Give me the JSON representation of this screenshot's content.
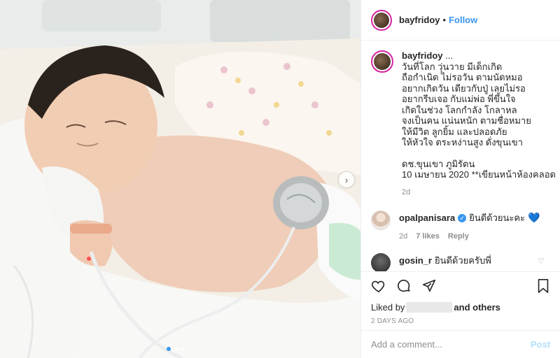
{
  "post": {
    "username": "bayfridoy",
    "follow_label": "Follow",
    "separator": "•",
    "caption_more": "...",
    "caption_lines": [
      "วันที่โลก วุ่นวาย มีเด็กเกิด",
      "ถือกำเนิด ไม่รอวัน ตามนัดหมอ",
      "อยากเกิดวัน เดียวกับปู่ เลยไม่รอ",
      "อยากรีบเจอ กับแม่พ่อ พี่ขึ้นใจ",
      "เกิดในช่วง โลกกำลัง โกลาหล",
      "จงเป็นคน แน่นหนัก ตามชื่อหมาย",
      "ให้มีวิต ลูกยิ้ม และปลอดภัย",
      "ให้หัวใจ ตระหง่านสูง ดั่งขุนเขา",
      "",
      "ดช.ขุนเขา ภูมิรัตน",
      "10 เมษายน 2020 **เขียนหน้าห้องคลอด"
    ],
    "caption_time": "2d"
  },
  "comments": [
    {
      "username": "opalpanisara",
      "verified_glyph": "✓",
      "text": "ยินดีด้วยนะคะ",
      "emoji": "💙",
      "time": "2d",
      "likes": "7 likes",
      "reply": "Reply",
      "like_glyph": "♡"
    },
    {
      "username": "gosin_r",
      "text": "ยินดีด้วยครับพี่",
      "like_glyph": "♡"
    }
  ],
  "liked": {
    "prefix": "Liked by",
    "and_others": "and others"
  },
  "date": "2 DAYS AGO",
  "add_comment": {
    "placeholder": "Add a comment...",
    "post_label": "Post"
  },
  "carousel": {
    "next_glyph": "›",
    "dot_count": 3,
    "active_index": 0
  },
  "colors": {
    "accent": "#3897f0",
    "post_disabled": "#b2dffc",
    "muted": "#8e8e8e"
  },
  "icons": [
    "heart-icon",
    "comment-icon",
    "share-icon",
    "bookmark-icon"
  ]
}
